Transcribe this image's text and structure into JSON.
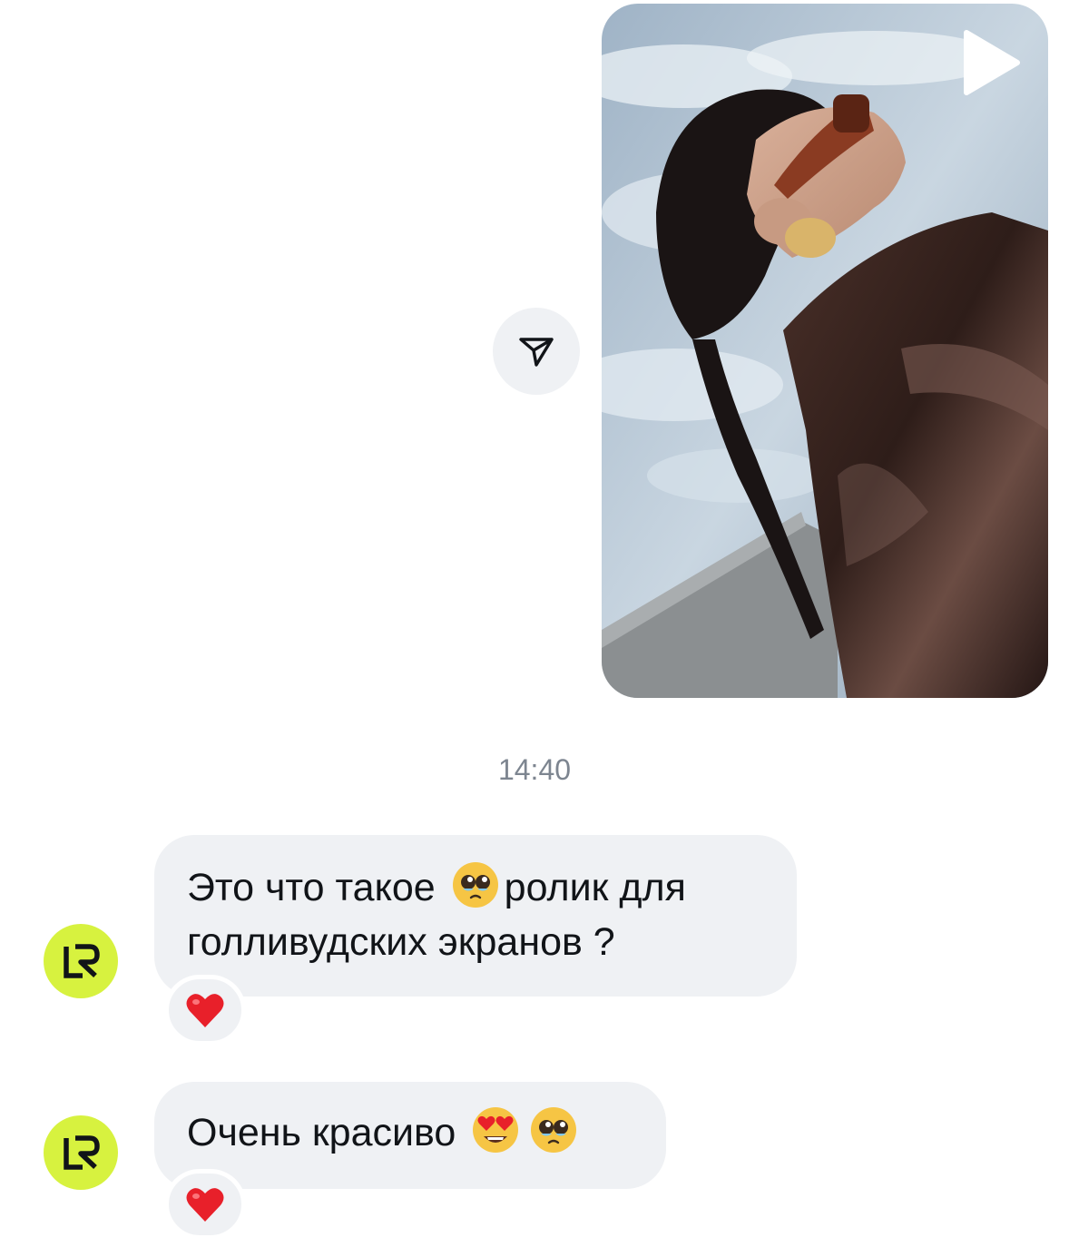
{
  "conversation": {
    "shared_video": {
      "thumbnail": "woman-in-sunglasses-rooftop",
      "play_icon": "play-icon",
      "share_icon": "send-icon"
    },
    "timestamp": "14:40",
    "messages": [
      {
        "sender_avatar": "LR",
        "lines": [
          [
            "Это что такое ",
            "ролик для"
          ],
          [
            "голливудских экранов ?"
          ]
        ],
        "emojis": [
          "pleading-face-emoji"
        ],
        "reaction": "red-heart-emoji"
      },
      {
        "sender_avatar": "LR",
        "text": "Очень красиво",
        "emojis": [
          "heart-eyes-emoji",
          "pleading-face-emoji"
        ],
        "reaction": "red-heart-emoji"
      }
    ]
  },
  "colors": {
    "avatar_bg": "#d7f23f",
    "bubble_bg": "#eff1f4",
    "timestamp": "#7d8590",
    "heart": "#e8202a"
  }
}
